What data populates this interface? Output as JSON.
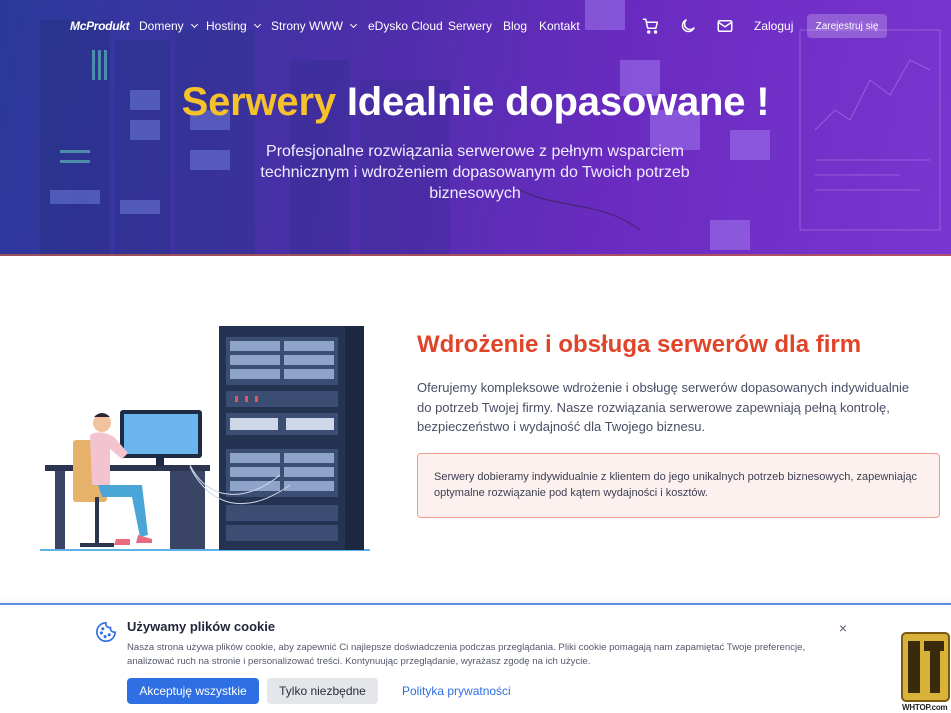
{
  "nav": {
    "logo": "McProdukt",
    "items": [
      {
        "label": "Domeny",
        "dropdown": true
      },
      {
        "label": "Hosting",
        "dropdown": true
      },
      {
        "label": "Strony WWW",
        "dropdown": true
      },
      {
        "label": "eDysko Cloud",
        "dropdown": false
      },
      {
        "label": "Serwery",
        "dropdown": false
      },
      {
        "label": "Blog",
        "dropdown": false
      },
      {
        "label": "Kontakt",
        "dropdown": false
      }
    ],
    "icons": [
      "cart-icon",
      "moon-icon",
      "mail-icon"
    ],
    "login": "Zaloguj",
    "register": "Zarejestruj się"
  },
  "hero": {
    "title_highlight": "Serwery",
    "title_rest": "Idealnie dopasowane !",
    "subtitle": "Profesjonalne rozwiązania serwerowe z pełnym wsparciem technicznym i wdrożeniem dopasowanym do Twoich potrzeb biznesowych"
  },
  "section": {
    "title": "Wdrożenie i obsługa serwerów dla firm",
    "text": "Oferujemy kompleksowe wdrożenie i obsługę serwerów dopasowanych indywidualnie do potrzeb Twojej firmy. Nasze rozwiązania serwerowe zapewniają pełną kontrolę, bezpieczeństwo i wydajność dla Twojego biznesu.",
    "notice": "Serwery dobieramy indywidualnie z klientem do jego unikalnych potrzeb biznesowych, zapewniając optymalne rozwiązanie pod kątem wydajności i kosztów."
  },
  "cookie": {
    "title": "Używamy plików cookie",
    "text": "Nasza strona używa plików cookie, aby zapewnić Ci najlepsze doświadczenia podczas przeglądania. Pliki cookie pomagają nam zapamiętać Twoje preferencje, analizować ruch na stronie i personalizować treści. Kontynuując przeglądanie, wyrażasz zgodę na ich użycie.",
    "accept": "Akceptuję wszystkie",
    "necessary": "Tylko niezbędne",
    "privacy": "Polityka prywatności",
    "close": "×"
  },
  "watermark": "WHTOP.com",
  "colors": {
    "accent_orange": "#e0452a",
    "highlight_yellow": "#f6c22a",
    "button_blue": "#2f6fe4",
    "hero_purple": "#5a2fb4"
  }
}
